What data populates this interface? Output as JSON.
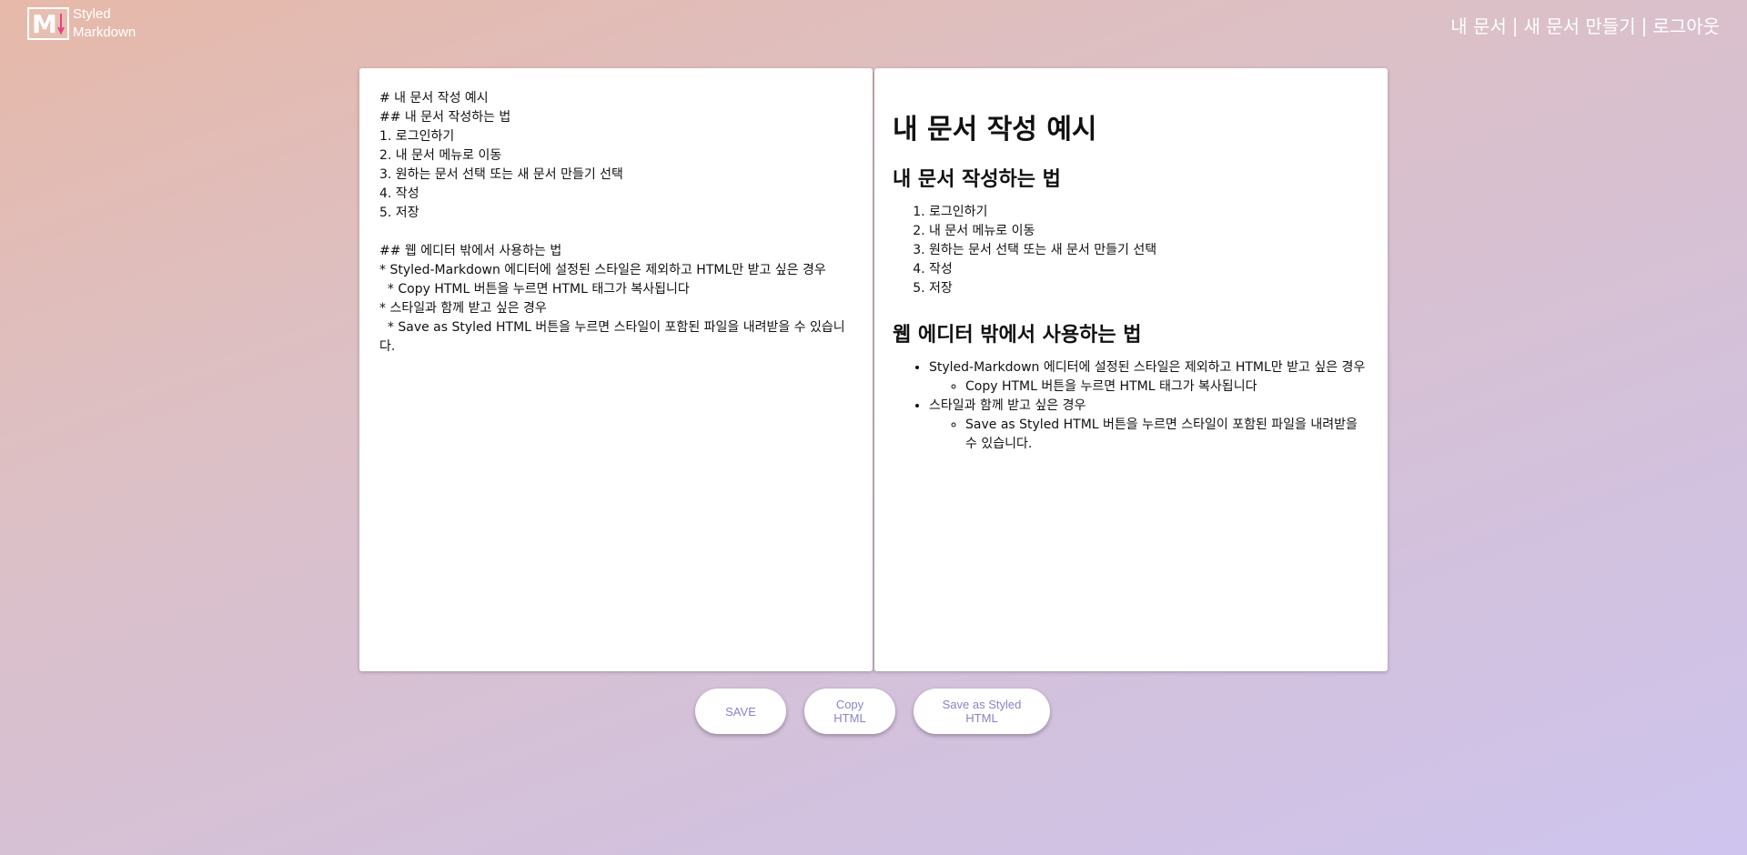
{
  "brand": {
    "line1": "Styled",
    "line2": "Markdown"
  },
  "nav": {
    "my_docs": "내 문서",
    "new_doc": "새 문서 만들기",
    "logout": "로그아웃",
    "separator": "|"
  },
  "editor": {
    "source": "# 내 문서 작성 예시\n## 내 문서 작성하는 법\n1. 로그인하기\n2. 내 문서 메뉴로 이동\n3. 원하는 문서 선택 또는 새 문서 만들기 선택\n4. 작성\n5. 저장\n\n## 웹 에디터 밖에서 사용하는 법\n* Styled-Markdown 에디터에 설정된 스타일은 제외하고 HTML만 받고 싶은 경우\n  * Copy HTML 버튼을 누르면 HTML 태그가 복사됩니다\n* 스타일과 함께 받고 싶은 경우\n  * Save as Styled HTML 버튼을 누르면 스타일이 포함된 파일을 내려받을 수 있습니다."
  },
  "preview": {
    "h1": "내 문서 작성 예시",
    "h2_a": "내 문서 작성하는 법",
    "steps": [
      "로그인하기",
      "내 문서 메뉴로 이동",
      "원하는 문서 선택 또는 새 문서 만들기 선택",
      "작성",
      "저장"
    ],
    "h2_b": "웹 에디터 밖에서 사용하는 법",
    "bullet1": "Styled-Markdown 에디터에 설정된 스타일은 제외하고 HTML만 받고 싶은 경우",
    "bullet1_sub": "Copy HTML 버튼을 누르면 HTML 태그가 복사됩니다",
    "bullet2": "스타일과 함께 받고 싶은 경우",
    "bullet2_sub": "Save as Styled HTML 버튼을 누르면 스타일이 포함된 파일을 내려받을 수 있습니다."
  },
  "buttons": {
    "save": "SAVE",
    "copy_html": "Copy HTML",
    "save_styled": "Save as Styled HTML"
  },
  "colors": {
    "button_text": "#8a83c9",
    "logo_accent": "#e0457b"
  }
}
